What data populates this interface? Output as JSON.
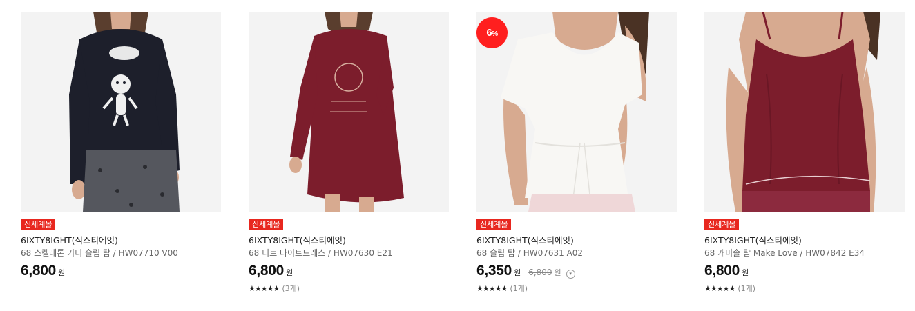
{
  "products": [
    {
      "badge": "신세계몰",
      "brand": "6IXTY8IGHT(식스티에잇)",
      "name": "68 스켈레톤 키티 슬립 탑 / HW07710 V00",
      "price": "6,800",
      "currency": "원",
      "discount": null,
      "original_price": null,
      "stars": null,
      "review_count": null,
      "image": "black-longsleeve-skeleton-kitty-top"
    },
    {
      "badge": "신세계몰",
      "brand": "6IXTY8IGHT(식스티에잇)",
      "name": "68 니트 나이트드레스 / HW07630 E21",
      "price": "6,800",
      "currency": "원",
      "discount": null,
      "original_price": null,
      "stars": "★★★★★",
      "review_count": "(3개)",
      "image": "burgundy-knit-nightdress"
    },
    {
      "badge": "신세계몰",
      "brand": "6IXTY8IGHT(식스티에잇)",
      "name": "68 슬립 탑 / HW07631 A02",
      "price": "6,350",
      "currency": "원",
      "discount": "6",
      "discount_unit": "%",
      "original_price": "6,800",
      "original_currency": "원",
      "stars": "★★★★★",
      "review_count": "(1개)",
      "image": "white-vneck-drawstring-top"
    },
    {
      "badge": "신세계몰",
      "brand": "6IXTY8IGHT(식스티에잇)",
      "name": "68 캐미솔 탑 Make Love / HW07842 E34",
      "price": "6,800",
      "currency": "원",
      "discount": null,
      "original_price": null,
      "stars": "★★★★★",
      "review_count": "(1개)",
      "image": "burgundy-satin-camisole"
    }
  ],
  "colors": {
    "badge_bg": "#e8271f",
    "discount_bg": "#ff1f1f",
    "black_top": "#1d1f2b",
    "burgundy": "#7c1d2c",
    "white_top": "#f8f7f4",
    "skin": "#d7aa90",
    "hair": "#5a3e2e"
  }
}
